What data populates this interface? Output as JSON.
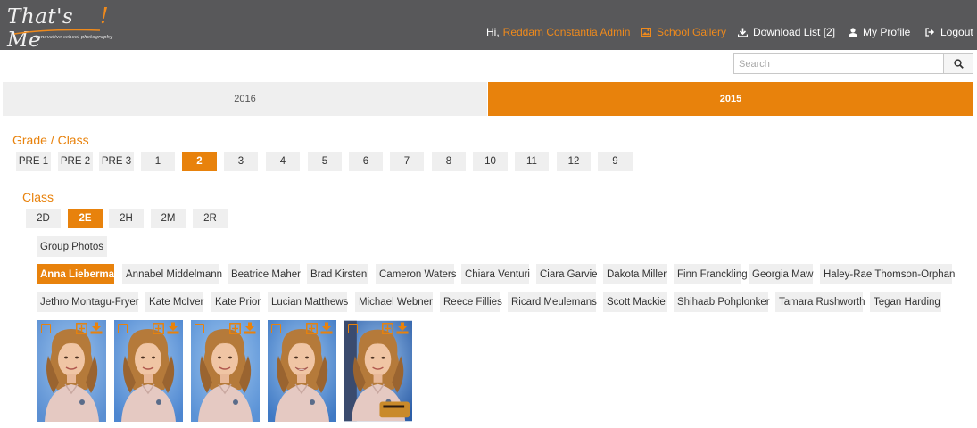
{
  "header": {
    "logo_text": "That's Me",
    "logo_excl": "!",
    "logo_tagline": "Innovative school photography",
    "greeting": "Hi,",
    "user_name": "Reddam Constantia Admin",
    "gallery_label": "School Gallery",
    "download_label": "Download List [2]",
    "profile_label": "My Profile",
    "logout_label": "Logout"
  },
  "search": {
    "placeholder": "Search"
  },
  "years": [
    {
      "label": "2016",
      "active": false
    },
    {
      "label": "2015",
      "active": true
    }
  ],
  "grade_section": {
    "title": "Grade / Class",
    "grades": [
      "PRE 1",
      "PRE 2",
      "PRE 3",
      "1",
      "2",
      "3",
      "4",
      "5",
      "6",
      "7",
      "8",
      "10",
      "11",
      "12",
      "9"
    ],
    "active": "2"
  },
  "class_section": {
    "title": "Class",
    "classes": [
      "2D",
      "2E",
      "2H",
      "2M",
      "2R"
    ],
    "active": "2E"
  },
  "group_photos_label": "Group Photos",
  "students": {
    "row1": [
      "Anna Lieberman",
      "Annabel Middelmann",
      "Beatrice Maher",
      "Brad Kirsten",
      "Cameron Waters",
      "Chiara Venturi",
      "Ciara Garvie",
      "Dakota Miller",
      "Finn Franckling",
      "Georgia Maw",
      "Haley-Rae Thomson-Orphan"
    ],
    "row2": [
      "Jethro Montagu-Fryer",
      "Kate McIver",
      "Kate Prior",
      "Lucian Matthews",
      "Michael Webner",
      "Reece Fillies",
      "Ricard Meulemans",
      "Scott Mackie",
      "Shihaab Pohplonker",
      "Tamara Rushworth",
      "Tegan Harding"
    ],
    "active": "Anna Lieberman"
  },
  "photos": [
    "portrait-1",
    "portrait-2",
    "portrait-3",
    "portrait-4",
    "portrait-5"
  ],
  "colors": {
    "header_bg": "#58585a",
    "accent": "#e8820c",
    "chip_bg": "#efefef"
  },
  "icons": {
    "gallery": "image-icon",
    "download": "download-icon",
    "profile": "user-icon",
    "logout": "logout-icon",
    "search": "search-icon",
    "select": "checkbox-icon",
    "expand": "expand-icon"
  }
}
